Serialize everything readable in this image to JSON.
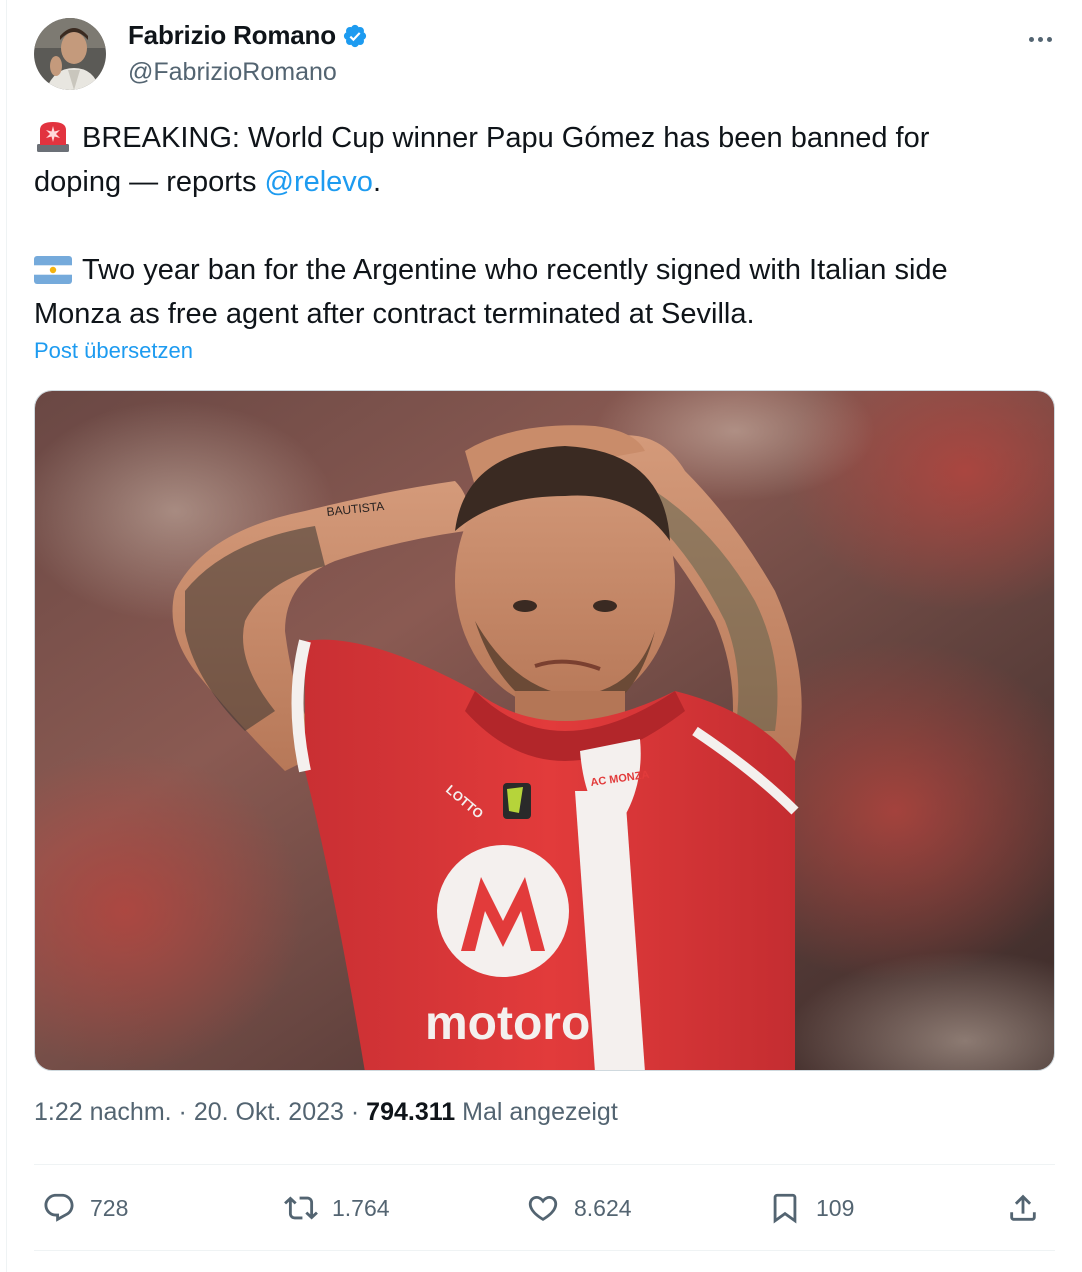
{
  "author": {
    "display_name": "Fabrizio Romano",
    "handle": "@FabrizioRomano",
    "verified": true
  },
  "tweet": {
    "line1_prefix": "BREAKING: World Cup winner Papu Gómez has been banned for",
    "line2_prefix": "doping — reports ",
    "mention": "@relevo",
    "line2_suffix": ".",
    "line3": "Two year ban for the Argentine who recently signed with Italian side",
    "line4": "Monza as free agent after contract terminated at Sevilla.",
    "emoji_1": "rotating-light",
    "emoji_2": "argentina-flag"
  },
  "translate_label": "Post übersetzen",
  "media": {
    "description": "photo",
    "shirt_sponsor": "motorola",
    "shirt_badge": "AC MONZA",
    "shirt_maker": "LOTTO",
    "tattoo_text": "BAUTISTA"
  },
  "meta": {
    "time": "1:22 nachm.",
    "date": "20. Okt. 2023",
    "views_count": "794.311",
    "views_label": "Mal angezeigt"
  },
  "actions": {
    "replies": "728",
    "reposts": "1.764",
    "likes": "8.624",
    "bookmarks": "109"
  },
  "colors": {
    "accent": "#1d9bf0",
    "secondary_text": "#536471",
    "jersey_red": "#e23b3b"
  }
}
